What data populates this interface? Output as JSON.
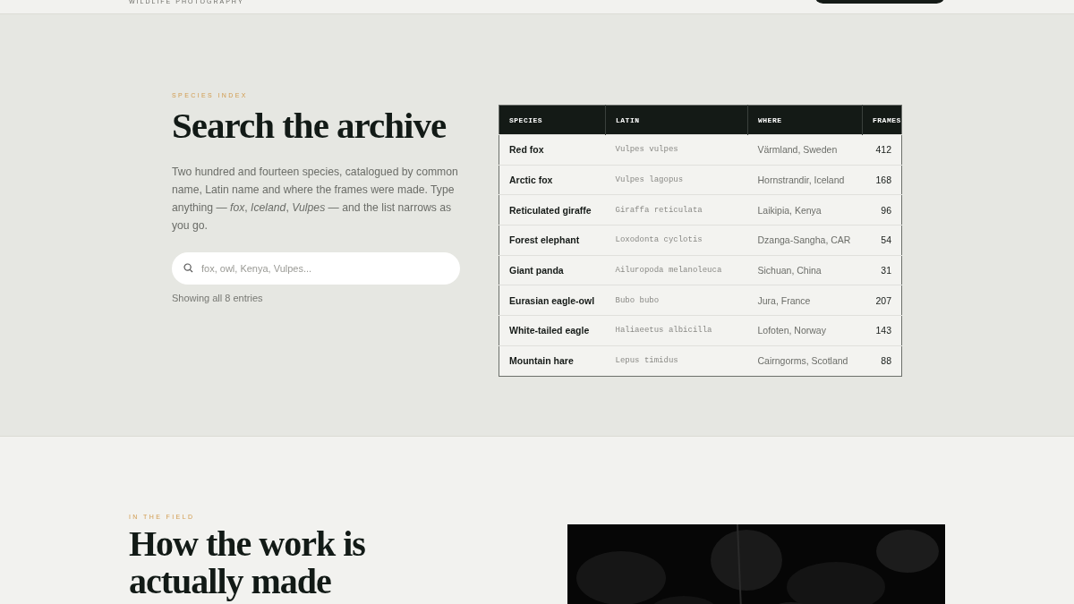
{
  "header": {
    "tagline": "WILDLIFE PHOTOGRAPHY"
  },
  "index_section": {
    "eyebrow": "SPECIES INDEX",
    "title": "Search the archive",
    "intro": "Two hundred and fourteen species, catalogued by common name, Latin name and where the frames were made. Type anything — *fox*, *Iceland*, *Vulpes* — and the list narrows as you go.",
    "search": {
      "placeholder": "fox, owl, Kenya, Vulpes..."
    },
    "result_count": "Showing all 8 entries",
    "table": {
      "columns": [
        "SPECIES",
        "LATIN",
        "WHERE",
        "FRAMES"
      ],
      "rows": [
        [
          "Red fox",
          "Vulpes vulpes",
          "Värmland, Sweden",
          "412"
        ],
        [
          "Arctic fox",
          "Vulpes lagopus",
          "Hornstrandir, Iceland",
          "168"
        ],
        [
          "Reticulated giraffe",
          "Giraffa reticulata",
          "Laikipia, Kenya",
          "96"
        ],
        [
          "Forest elephant",
          "Loxodonta cyclotis",
          "Dzanga-Sangha, CAR",
          "54"
        ],
        [
          "Giant panda",
          "Ailuropoda melanoleuca",
          "Sichuan, China",
          "31"
        ],
        [
          "Eurasian eagle-owl",
          "Bubo bubo",
          "Jura, France",
          "207"
        ],
        [
          "White-tailed eagle",
          "Haliaeetus albicilla",
          "Lofoten, Norway",
          "143"
        ],
        [
          "Mountain hare",
          "Lepus timidus",
          "Cairngorms, Scotland",
          "88"
        ]
      ]
    }
  },
  "field_section": {
    "eyebrow": "IN THE FIELD",
    "title": "How the work is actually made"
  }
}
